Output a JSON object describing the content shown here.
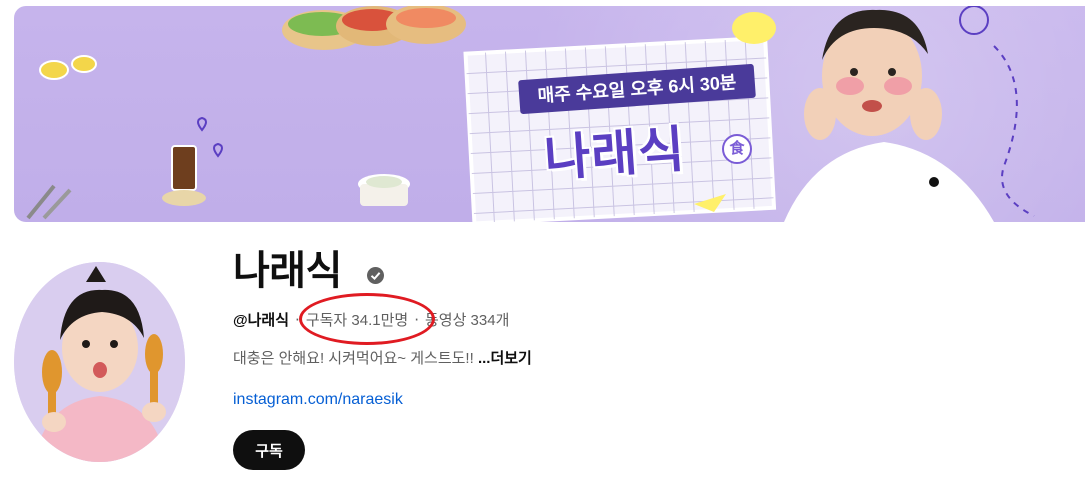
{
  "banner": {
    "schedule_text": "매주 수요일 오후 6시 30분",
    "title_art": "나래식",
    "hanja_badge": "食"
  },
  "channel": {
    "name": "나래식",
    "handle": "@나래식",
    "subscribers": "구독자 34.1만명",
    "video_count": "동영상 334개",
    "meta_separator": "‧",
    "description": "대충은 안해요! 시켜먹어요~ 게스트도!!",
    "more_label": "...더보기",
    "link": "instagram.com/naraesik"
  },
  "actions": {
    "subscribe_label": "구독"
  },
  "colors": {
    "banner_bg": "#c6b4ec",
    "link": "#065fd4",
    "highlight": "#e01b22",
    "subscribe_bg": "#0f0f0f"
  }
}
